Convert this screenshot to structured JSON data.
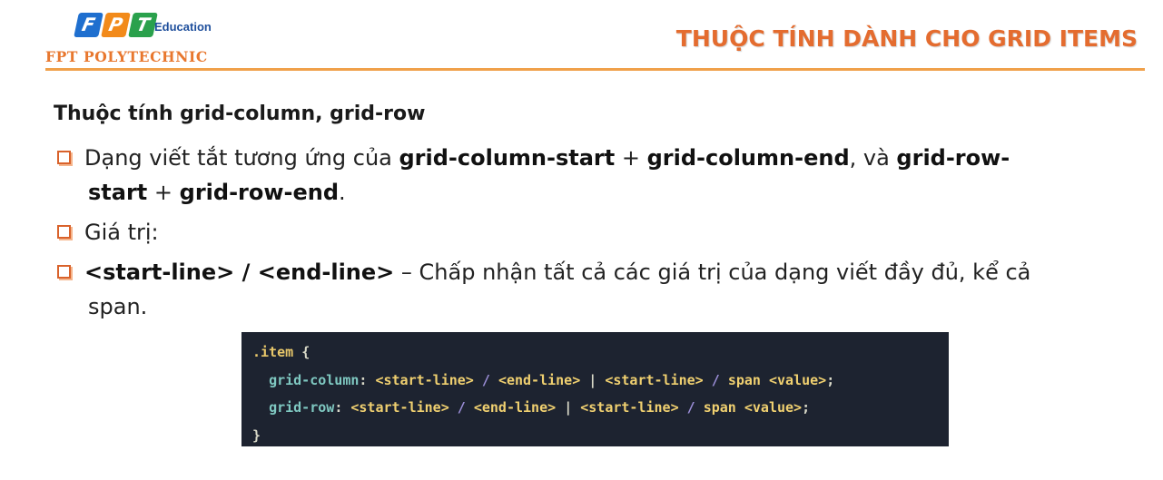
{
  "header": {
    "logo_letters": [
      "F",
      "P",
      "T"
    ],
    "logo_education": "Education",
    "logo_school": "FPT POLYTECHNIC",
    "title": "THUỘC TÍNH DÀNH CHO GRID ITEMS"
  },
  "content": {
    "subheading": "Thuộc tính grid-column, grid-row",
    "bullets": [
      {
        "t1": "Dạng viết tắt tương ứng của ",
        "b1": "grid-column-start",
        "t2": " + ",
        "b2": "grid-column-end",
        "t3": ", và ",
        "b3": "grid-row-",
        "b4": "start",
        "t4": " + ",
        "b5": "grid-row-end",
        "t5": "."
      },
      {
        "text": "Giá trị:"
      },
      {
        "b1": "<start-line> / <end-line>",
        "t1": " – Chấp nhận tất cả các giá trị của dạng viết đầy đủ, kể cả",
        "t2": "span."
      }
    ]
  },
  "code": {
    "selector": ".item",
    "open_brace": "{",
    "close_brace": "}",
    "lines": [
      {
        "property": "grid-column",
        "v1": "<start-line>",
        "v2": "<end-line>",
        "v3": "<start-line>",
        "v4": "span <value>"
      },
      {
        "property": "grid-row",
        "v1": "<start-line>",
        "v2": "<end-line>",
        "v3": "<start-line>",
        "v4": "span <value>"
      }
    ]
  },
  "colors": {
    "accent": "#e46c2f",
    "divider": "#f0a04a",
    "code_background": "#1d2330"
  }
}
